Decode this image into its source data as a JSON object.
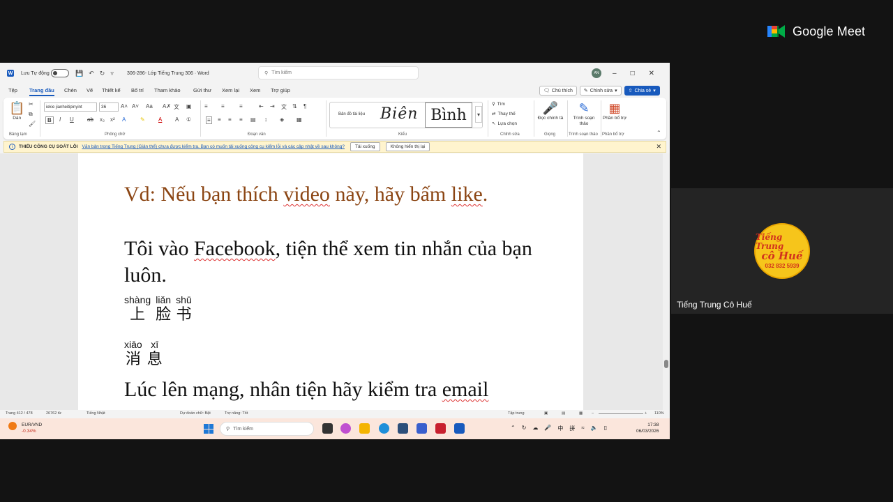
{
  "meet": {
    "brand": "Google Meet",
    "presenter_name": "Tiếng Trung Cô Huế",
    "avatar_line1": "Tiếng Trung",
    "avatar_line2": "cô Huế",
    "avatar_phone": "032 832 5939"
  },
  "word": {
    "autosave_label": "Lưu Tự động",
    "doc_title": "306-286- Lớp Tiếng Trung 306  ·  Word",
    "search_placeholder": "Tìm kiếm",
    "user_initials": "AN",
    "menu": [
      "Tệp",
      "Trang đầu",
      "Chèn",
      "Vẽ",
      "Thiết kế",
      "Bố trí",
      "Tham khảo",
      "Gửi thư",
      "Xem lại",
      "Xem",
      "Trợ giúp"
    ],
    "buttons": {
      "comment": "Chú thích",
      "editing": "Chỉnh sửa",
      "share": "Chia sẻ"
    },
    "ribbon": {
      "paste": "Dán",
      "clipboard": "Bảng tạm",
      "font_name": "iekie jianheitipinyint",
      "font_size": "36",
      "font_group": "Phông chữ",
      "paragraph_group": "Đoạn văn",
      "style_normal": "Bản đồ tài liệu",
      "style_heading": "Biên",
      "style_title": "Bình",
      "styles_group": "Kiểu",
      "find": "Tìm",
      "replace": "Thay thế",
      "select": "Lựa chọn",
      "editing_group": "Chỉnh sửa",
      "dictate": "Đọc chính tả",
      "voice_group": "Giọng",
      "editor": "Trình soạn thảo",
      "editor_group": "Trình soạn thảo",
      "addins": "Phần bổ trợ",
      "addins_group": "Phần bổ trợ"
    },
    "infobar": {
      "title": "THIẾU CÔNG CỤ SOÁT LỖI",
      "message": "Văn bản trong Tiếng Trung (Giản thể) chưa được kiểm tra. Bạn có muốn tải xuống công cụ kiểm lỗi và các cập nhật về sau không?",
      "download": "Tải xuống",
      "dismiss": "Không hiển thị lại"
    },
    "document": {
      "example_prefix": "Vd: Nếu bạn thích ",
      "example_video": "video",
      "example_suffix": " này, hãy bấm ",
      "example_like": "like",
      "example_end": ".",
      "para1_a": "Tôi vào ",
      "para1_fb": "Facebook",
      "para1_b": ", tiện thể xem tin nhắn của bạn luôn.",
      "ruby1": [
        {
          "pinyin": "shàng",
          "hanzi": "上"
        },
        {
          "pinyin": "liǎn",
          "hanzi": "脸"
        },
        {
          "pinyin": "shū",
          "hanzi": "书"
        }
      ],
      "ruby2": [
        {
          "pinyin": "xiāo",
          "hanzi": "消"
        },
        {
          "pinyin": "xī",
          "hanzi": "息"
        }
      ],
      "para2_a": "Lúc lên mạng, nhân tiện hãy kiểm tra ",
      "para2_email": "email"
    },
    "status": {
      "page": "Trang 412 / 478",
      "words": "26762 từ",
      "language": "Tiếng Nhật",
      "predict": "Dự đoán chữ: Bật",
      "accessibility": "Trợ năng: Tốt",
      "focus": "Tập trung",
      "zoom": "110%"
    }
  },
  "taskbar": {
    "stock_name": "EUR/VND",
    "stock_change": "-0.34%",
    "search": "Tìm kiếm",
    "time": "17:38",
    "date": "06/03/2026",
    "lang": "中",
    "ime": "拼"
  },
  "colors": {
    "word_blue": "#185abd",
    "example_brown": "#8b4513"
  }
}
